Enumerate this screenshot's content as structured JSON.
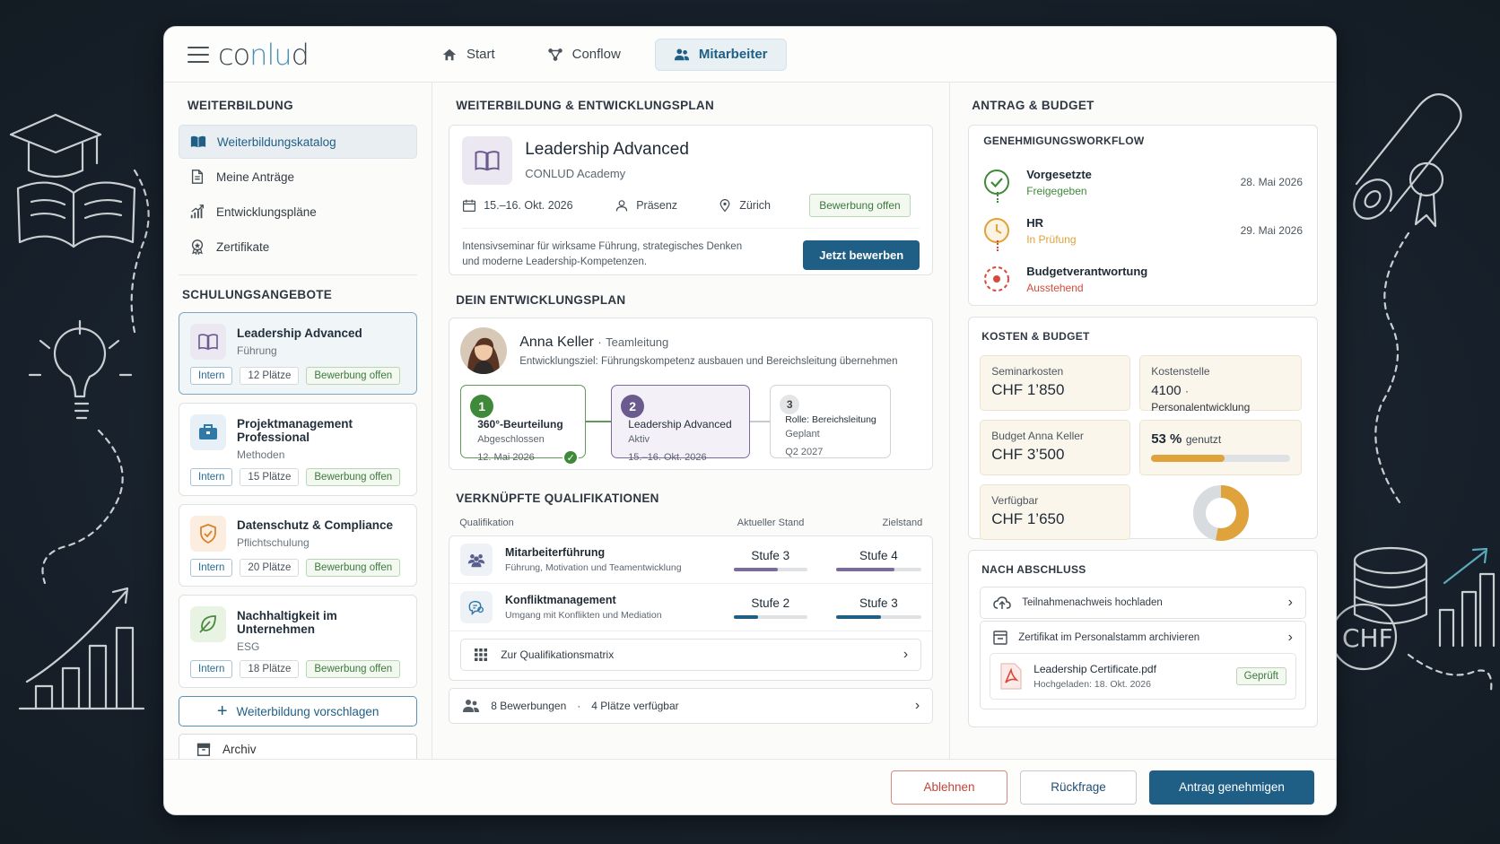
{
  "app": {
    "logo_pre": "co",
    "logo_mid": "nlu",
    "logo_post": "d",
    "nav": [
      {
        "label": "Start",
        "icon": "home-icon"
      },
      {
        "label": "Conflow",
        "icon": "flow-icon"
      },
      {
        "label": "Mitarbeiter",
        "icon": "people-icon",
        "active": true
      }
    ]
  },
  "sidebar": {
    "heading": "WEITERBILDUNG",
    "menu": [
      {
        "label": "Weiterbildungskatalog",
        "icon": "book-icon",
        "active": true
      },
      {
        "label": "Meine Anträge",
        "icon": "document-icon"
      },
      {
        "label": "Entwicklungspläne",
        "icon": "chart-icon"
      },
      {
        "label": "Zertifikate",
        "icon": "badge-icon"
      }
    ],
    "courses_heading": "SCHULUNGSANGEBOTE",
    "courses": [
      {
        "title": "Leadership Advanced",
        "category": "Führung",
        "tag1": "Intern",
        "places": "12 Plätze",
        "status": "Bewerbung offen",
        "icon": "book-icon",
        "color": "#6b5a8e",
        "bg": "#ece8f2"
      },
      {
        "title": "Projektmanagement Professional",
        "category": "Methoden",
        "tag1": "Intern",
        "places": "15 Plätze",
        "status": "Bewerbung offen",
        "icon": "briefcase-icon",
        "color": "#2f78a8",
        "bg": "#e6f0f6"
      },
      {
        "title": "Datenschutz & Compliance",
        "category": "Pflichtschulung",
        "tag1": "Intern",
        "places": "20 Plätze",
        "status": "Bewerbung offen",
        "icon": "shield-icon",
        "color": "#d9822b",
        "bg": "#fbeee0"
      },
      {
        "title": "Nachhaltigkeit im Unternehmen",
        "category": "ESG",
        "tag1": "Intern",
        "places": "18 Plätze",
        "status": "Bewerbung offen",
        "icon": "leaf-icon",
        "color": "#4a8a3c",
        "bg": "#e9f3e4"
      }
    ],
    "suggest_label": "Weiterbildung vorschlagen",
    "archive_label": "Archiv"
  },
  "main": {
    "heading": "WEITERBILDUNG & ENTWICKLUNGSPLAN",
    "featured": {
      "title": "Leadership Advanced",
      "org": "CONLUD Academy",
      "date": "15.–16. Okt. 2026",
      "mode": "Präsenz",
      "location": "Zürich",
      "status": "Bewerbung offen",
      "description": "Intensivseminar für wirksame Führung, strategisches Denken und moderne Leadership-Kompetenzen.",
      "apply_label": "Jetzt bewerben"
    },
    "plan_heading": "DEIN ENTWICKLUNGSPLAN",
    "person": {
      "name": "Anna Keller",
      "role": "Teamleitung",
      "goal": "Entwicklungsziel: Führungskompetenz ausbauen und Bereichsleitung übernehmen"
    },
    "steps": [
      {
        "num": "1",
        "title": "360°-Beurteilung",
        "status": "Abgeschlossen",
        "date": "12. Mai 2026"
      },
      {
        "num": "2",
        "title": "Leadership Advanced",
        "status": "Aktiv",
        "date": "15.–16. Okt. 2026"
      },
      {
        "num": "3",
        "title": "Rolle: Bereichsleitung",
        "status": "Geplant",
        "date": "Q2 2027"
      }
    ],
    "quals_heading": "VERKNÜPFTE QUALIFIKATIONEN",
    "quals_cols": {
      "name": "Qualifikation",
      "current": "Aktueller Stand",
      "target": "Zielstand"
    },
    "quals": [
      {
        "name": "Mitarbeiterführung",
        "desc": "Führung, Motivation und Teamentwicklung",
        "current": "Stufe 3",
        "target": "Stufe 4",
        "current_pct": 60,
        "target_pct": 68,
        "icon": "team-icon"
      },
      {
        "name": "Konfliktmanagement",
        "desc": "Umgang mit Konflikten und Mediation",
        "current": "Stufe 2",
        "target": "Stufe 3",
        "current_pct": 33,
        "target_pct": 53,
        "icon": "conflict-icon"
      }
    ],
    "matrix_label": "Zur Qualifikationsmatrix",
    "applications": "8 Bewerbungen",
    "places_available": "4 Plätze verfügbar"
  },
  "right": {
    "heading": "ANTRAG & BUDGET",
    "workflow_heading": "GENEHMIGUNGSWORKFLOW",
    "workflow": [
      {
        "name": "Vorgesetzte",
        "status": "Freigegeben",
        "date": "28. Mai 2026",
        "color": "#3f8a3a"
      },
      {
        "name": "HR",
        "status": "In Prüfung",
        "date": "29. Mai 2026",
        "color": "#e0a23a"
      },
      {
        "name": "Budgetverantwortung",
        "status": "Ausstehend",
        "date": "",
        "color": "#d64a3a"
      }
    ],
    "budget_heading": "KOSTEN & BUDGET",
    "seminar_label": "Seminarkosten",
    "seminar_value": "CHF 1’850",
    "cost_center_label": "Kostenstelle",
    "cost_center_value": "4100",
    "cost_center_name": "Personalentwicklung",
    "budget_label": "Budget Anna Keller",
    "budget_value": "CHF 3’500",
    "used_pct": "53 %",
    "used_label": "genutzt",
    "used_fraction": 0.53,
    "available_label": "Verfügbar",
    "available_value": "CHF 1’650",
    "after_heading": "NACH ABSCHLUSS",
    "after_links": [
      {
        "label": "Teilnahmenachweis hochladen",
        "icon": "upload-icon"
      },
      {
        "label": "Zertifikat im Personalstamm archivieren",
        "icon": "archive-icon"
      }
    ],
    "file_name": "Leadership Certificate.pdf",
    "file_uploaded": "Hochgeladen: 18. Okt. 2026",
    "file_status": "Geprüft"
  },
  "footer": {
    "reject": "Ablehnen",
    "query": "Rückfrage",
    "approve": "Antrag genehmigen"
  },
  "decor": {
    "chf": "CHF"
  }
}
